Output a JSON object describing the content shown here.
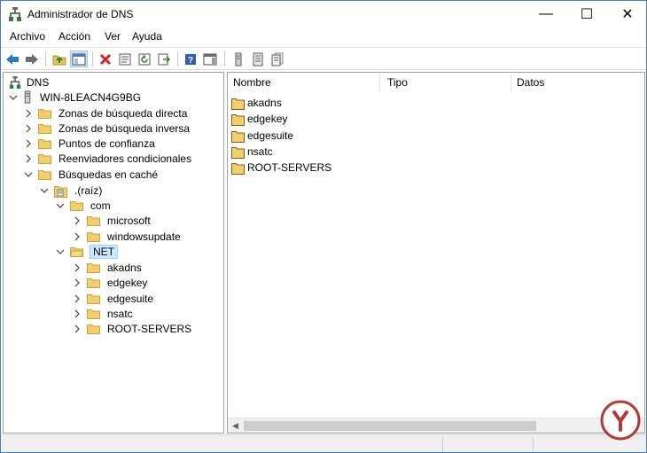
{
  "window": {
    "title": "Administrador de DNS",
    "controls": {
      "minimize": "—",
      "maximize": "☐",
      "close": "✕"
    }
  },
  "menu": {
    "items": [
      {
        "label": "Archivo"
      },
      {
        "label": "Acción"
      },
      {
        "label": "Ver"
      },
      {
        "label": "Ayuda"
      }
    ]
  },
  "toolbar": {
    "buttons": [
      {
        "icon": "back-arrow-icon"
      },
      {
        "icon": "forward-arrow-icon"
      },
      {
        "icon": "up-folder-icon"
      },
      {
        "icon": "show-hide-tree-icon",
        "active": true
      },
      {
        "icon": "delete-icon"
      },
      {
        "icon": "properties-icon"
      },
      {
        "icon": "refresh-icon"
      },
      {
        "icon": "export-list-icon"
      },
      {
        "icon": "help-icon"
      },
      {
        "icon": "show-action-pane-icon"
      },
      {
        "icon": "server-icon"
      },
      {
        "icon": "server-list-icon"
      },
      {
        "icon": "server-group-icon"
      }
    ]
  },
  "tree": {
    "root": {
      "label": "DNS"
    },
    "server": {
      "label": "WIN-8LEACN4G9BG"
    },
    "server_children": [
      {
        "label": "Zonas de búsqueda directa"
      },
      {
        "label": "Zonas de búsqueda inversa"
      },
      {
        "label": "Puntos de confianza"
      },
      {
        "label": "Reenviadores condicionales"
      },
      {
        "label": "Búsquedas en caché"
      }
    ],
    "root_zone": {
      "label": ".(raíz)"
    },
    "com": {
      "label": "com"
    },
    "com_children": [
      {
        "label": "microsoft"
      },
      {
        "label": "windowsupdate"
      }
    ],
    "net": {
      "label": "NET",
      "selected": true
    },
    "net_children": [
      {
        "label": "akadns"
      },
      {
        "label": "edgekey"
      },
      {
        "label": "edgesuite"
      },
      {
        "label": "nsatc"
      },
      {
        "label": "ROOT-SERVERS"
      }
    ]
  },
  "list": {
    "columns": [
      {
        "label": "Nombre"
      },
      {
        "label": "Tipo"
      },
      {
        "label": "Datos"
      }
    ],
    "rows": [
      {
        "name": "akadns"
      },
      {
        "name": "edgekey"
      },
      {
        "name": "edgesuite"
      },
      {
        "name": "nsatc"
      },
      {
        "name": "ROOT-SERVERS"
      }
    ]
  },
  "colors": {
    "selection": "#cce8ff",
    "folder": "#e8c05a",
    "accent": "#4a7ebb"
  }
}
